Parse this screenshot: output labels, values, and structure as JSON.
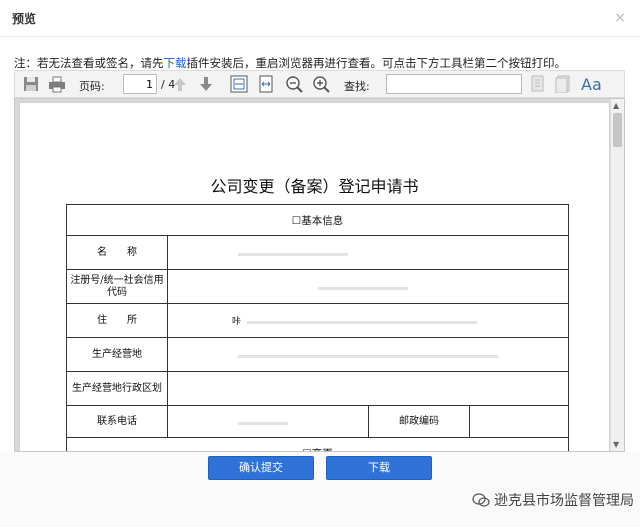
{
  "dialog": {
    "title": "预览",
    "close_glyph": "×"
  },
  "notice": {
    "before": "注：若无法查看或签名，请先",
    "link": "下载",
    "after": "插件安装后，重启浏览器再进行查看。可点击下方工具栏第二个按钮打印。"
  },
  "toolbar": {
    "page_label": "页码:",
    "page_value": "1",
    "page_total": "/ 4",
    "find_label": "查找:",
    "find_value": "",
    "font_glyph": "Aa",
    "icons": [
      "save-icon",
      "print-icon",
      "arrow-up-icon",
      "arrow-down-icon",
      "fit-page-icon",
      "fit-width-icon",
      "zoom-out-icon",
      "zoom-in-icon",
      "find-prev-icon",
      "find-next-icon",
      "font-icon"
    ]
  },
  "document": {
    "title": "公司变更（备案）登记申请书",
    "section_basic": "☐基本信息",
    "rows": [
      {
        "label": "名　　称"
      },
      {
        "label": "注册号/统一社会信用代码"
      },
      {
        "label": "住　　所",
        "value": "咔"
      },
      {
        "label": "生产经营地"
      },
      {
        "label": "生产经营地行政区划"
      }
    ],
    "phone_label": "联系电话",
    "postcode_label": "邮政编码",
    "section_next": "☐变更"
  },
  "buttons": {
    "confirm": "确认提交",
    "download": "下载"
  },
  "watermark": "逊克县市场监督管理局",
  "colors": {
    "button": "#2f73d8",
    "link": "#1a64c8"
  }
}
